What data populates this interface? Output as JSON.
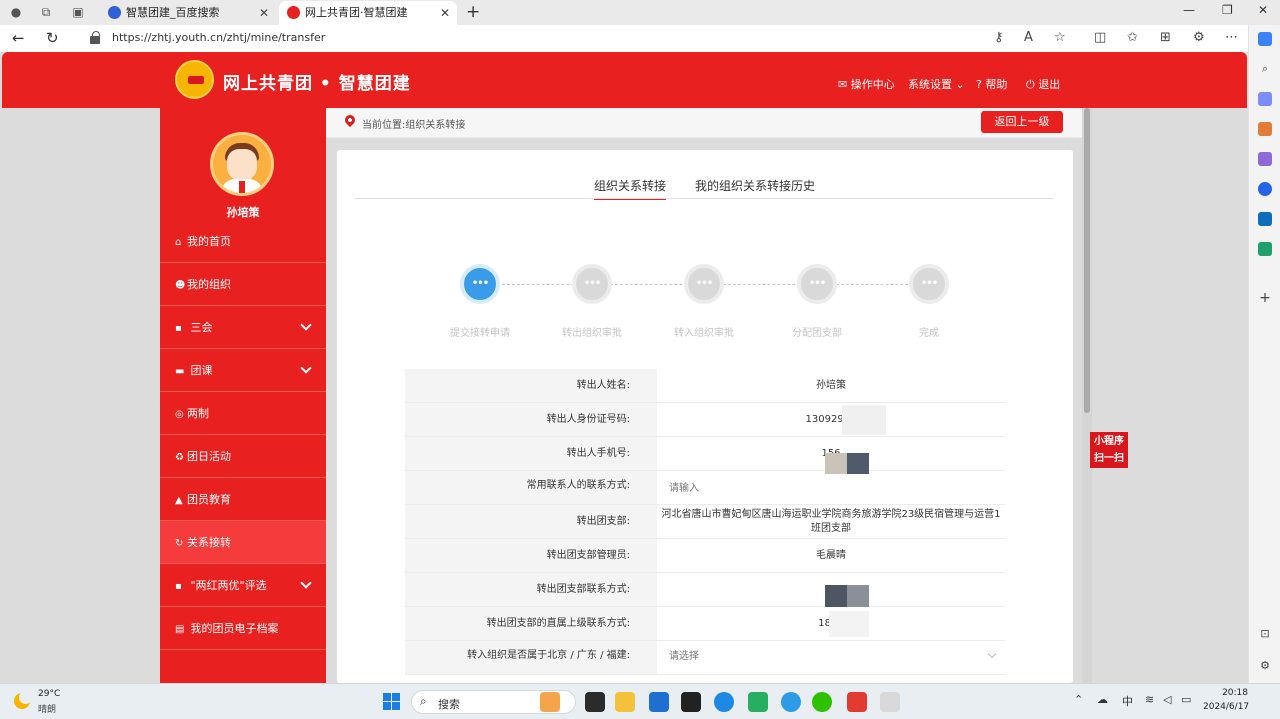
{
  "browser": {
    "tabs": [
      {
        "title": "智慧团建_百度搜索"
      },
      {
        "title": "网上共青团·智慧团建"
      }
    ],
    "url": "https://zhtj.youth.cn/zhtj/mine/transfer"
  },
  "site": {
    "title": "网上共青团 • 智慧团建",
    "nav": {
      "ops": "操作中心",
      "settings": "系统设置",
      "help": "帮助",
      "logout": "退出"
    }
  },
  "sidebar": {
    "user_name": "孙培策",
    "items": [
      {
        "label": "我的首页"
      },
      {
        "label": "我的组织"
      },
      {
        "label": "三会"
      },
      {
        "label": "团课"
      },
      {
        "label": "两制"
      },
      {
        "label": "团日活动"
      },
      {
        "label": "团员教育"
      },
      {
        "label": "关系接转"
      },
      {
        "label": "\"两红两优\"评选"
      },
      {
        "label": "我的团员电子档案"
      }
    ]
  },
  "breadcrumb": {
    "text": "当前位置:组织关系转接",
    "back_label": "返回上一级"
  },
  "content_tabs": {
    "active": "组织关系转接",
    "other": "我的组织关系转接历史"
  },
  "steps": [
    {
      "label": "提交接转申请",
      "glyph": "•••"
    },
    {
      "label": "转出组织审批",
      "glyph": "•••"
    },
    {
      "label": "转入组织审批",
      "glyph": "•••"
    },
    {
      "label": "分配团支部",
      "glyph": "•••"
    },
    {
      "label": "完成",
      "glyph": "•••"
    }
  ],
  "form": {
    "rows": [
      {
        "label": "转出人姓名:",
        "value": "孙培策"
      },
      {
        "label": "转出人身份证号码:",
        "value": "13092920"
      },
      {
        "label": "转出人手机号:",
        "value": "156"
      },
      {
        "label": "常用联系人的联系方式:",
        "value": "请输入"
      },
      {
        "label": "转出团支部:",
        "value": "河北省唐山市曹妃甸区唐山海运职业学院商务旅游学院23级民宿管理与运营1班团支部"
      },
      {
        "label": "转出团支部管理员:",
        "value": "毛晨晴"
      },
      {
        "label": "转出团支部联系方式:",
        "value": "18"
      },
      {
        "label": "转出团支部的直属上级联系方式:",
        "value": "1893"
      },
      {
        "label": "转入组织是否属于北京 / 广东 / 福建:",
        "value": "请选择"
      }
    ]
  },
  "floating": {
    "mini_program": "小程序扫一扫"
  },
  "taskbar": {
    "temp": "29°C",
    "weather": "晴朗",
    "search": "搜索",
    "ime": "中",
    "time": "20:18",
    "date": "2024/6/17"
  }
}
